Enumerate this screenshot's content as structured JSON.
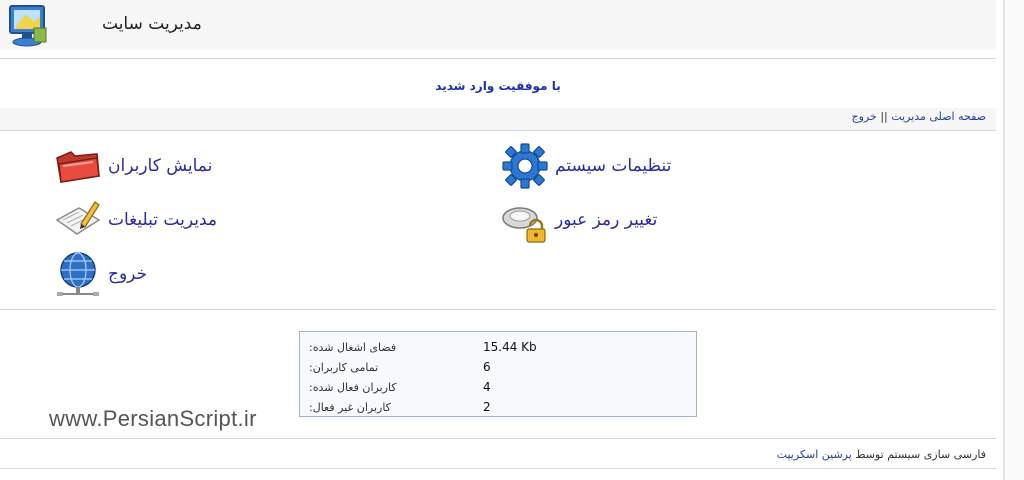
{
  "header": {
    "title": "مدیریت سایت"
  },
  "message": {
    "success": "با موفقیت وارد شدید"
  },
  "nav": {
    "home": "صفحه اصلی مدیریت",
    "separator": "||",
    "logout": "خروج"
  },
  "menu": {
    "users": "نمایش کاربران",
    "settings": "تنظیمات سیستم",
    "ads": "مدیریت تبلیغات",
    "password": "تغییر رمز عبور",
    "logout": "خروج"
  },
  "stats": {
    "rows": [
      {
        "label": "فضای اشغال شده:",
        "value": "15.44 Kb"
      },
      {
        "label": "تمامی کاربران:",
        "value": "6"
      },
      {
        "label": "کاربران فعال شده:",
        "value": "4"
      },
      {
        "label": "کاربران غیر فعال:",
        "value": "2"
      }
    ]
  },
  "watermark": "www.PersianScript.ir",
  "footer": {
    "text": "فارسی سازی سیستم توسط",
    "link": "پرشین اسکریپت"
  },
  "icons": {
    "logo": "computer-monitor-icon",
    "users": "red-folder-icon",
    "settings": "blue-gear-icon",
    "ads": "edit-document-icon",
    "password": "locked-keys-icon",
    "logout": "globe-network-icon"
  },
  "colors": {
    "link": "#2a2aa8",
    "success": "#1a2fb0",
    "border": "#9fb3c7"
  }
}
